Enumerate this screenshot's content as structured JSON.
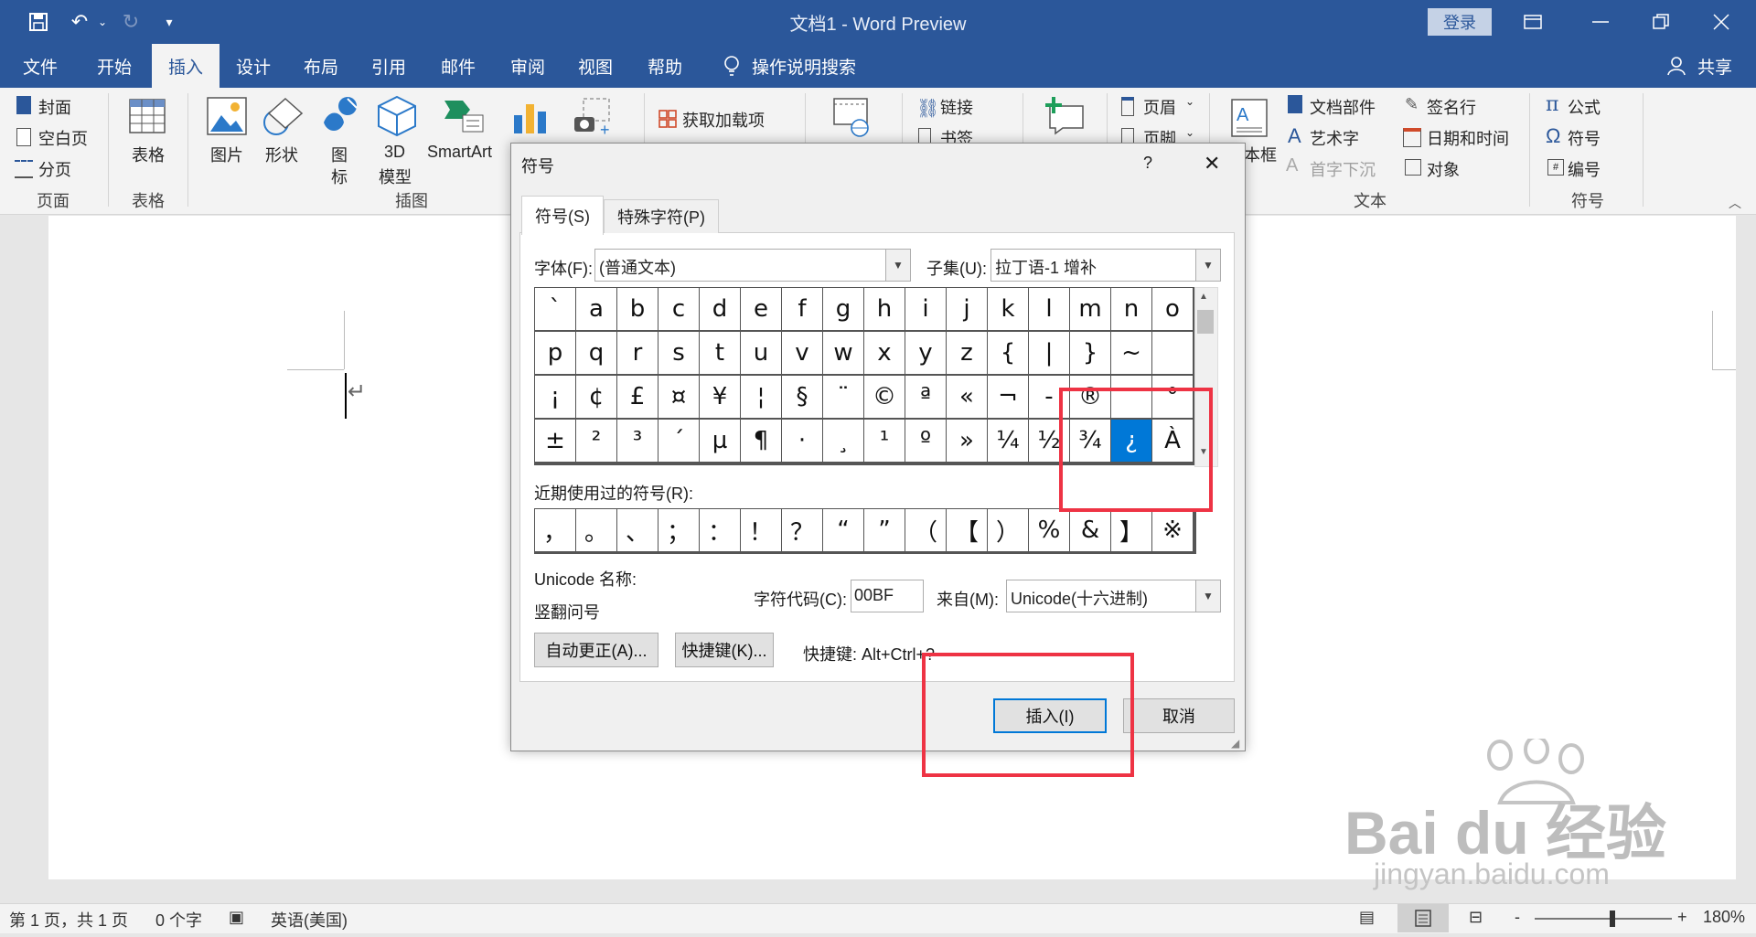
{
  "window": {
    "doc_title": "文档1  -  Word Preview",
    "login_label": "登录",
    "share_label": "共享"
  },
  "tabs": [
    "文件",
    "开始",
    "插入",
    "设计",
    "布局",
    "引用",
    "邮件",
    "审阅",
    "视图",
    "帮助"
  ],
  "tell_me": "操作说明搜索",
  "ribbon": {
    "pages": {
      "cover": "封面",
      "blank": "空白页",
      "break": "分页",
      "group": "页面"
    },
    "tables": {
      "table": "表格",
      "group": "表格"
    },
    "illustrations": {
      "picture": "图片",
      "shapes": "形状",
      "icons_1": "图",
      "icons_2": "标",
      "model_1": "3D",
      "model_2": "模型",
      "smartart": "SmartArt",
      "group": "插图"
    },
    "addins": {
      "get": "获取加载项"
    },
    "links": {
      "link": "链接",
      "bookmark": "书签"
    },
    "header_footer": {
      "header": "页眉",
      "footer": "页脚"
    },
    "text": {
      "textbox": "本框",
      "parts": "文档部件",
      "wordart": "艺术字",
      "dropcap": "首字下沉",
      "signature": "签名行",
      "datetime": "日期和时间",
      "object": "对象",
      "group": "文本"
    },
    "symbols": {
      "equation": "公式",
      "symbol": "符号",
      "number": "编号",
      "group": "符号"
    }
  },
  "dialog": {
    "title": "符号",
    "help": "?",
    "close": "✕",
    "tabs": [
      "符号(S)",
      "特殊字符(P)"
    ],
    "font_label": "字体(F):",
    "font_value": "(普通文本)",
    "subset_label": "子集(U):",
    "subset_value": "拉丁语-1 增补",
    "grid": [
      [
        "`",
        "a",
        "b",
        "c",
        "d",
        "e",
        "f",
        "g",
        "h",
        "i",
        "j",
        "k",
        "l",
        "m",
        "n",
        "o"
      ],
      [
        "p",
        "q",
        "r",
        "s",
        "t",
        "u",
        "v",
        "w",
        "x",
        "y",
        "z",
        "{",
        "|",
        "}",
        "~",
        ""
      ],
      [
        "¡",
        "¢",
        "£",
        "¤",
        "¥",
        "¦",
        "§",
        "¨",
        "©",
        "ª",
        "«",
        "¬",
        "-",
        "®",
        "",
        "°"
      ],
      [
        "±",
        "²",
        "³",
        "´",
        "µ",
        "¶",
        "·",
        "¸",
        "¹",
        "º",
        "»",
        "¼",
        "½",
        "¾",
        "¿",
        "À"
      ]
    ],
    "selected_char": "¿",
    "recent_label": "近期使用过的符号(R):",
    "recent": [
      "，",
      "。",
      "、",
      "；",
      "：",
      "！",
      "？",
      "“",
      "”",
      "（",
      "【",
      "）",
      "%",
      "&",
      "】",
      "※"
    ],
    "unicode_name_label": "Unicode 名称:",
    "unicode_name": "竖翻问号",
    "charcode_label": "字符代码(C):",
    "charcode_value": "00BF",
    "from_label": "来自(M):",
    "from_value": "Unicode(十六进制)",
    "autocorrect_btn": "自动更正(A)...",
    "shortcut_btn": "快捷键(K)...",
    "shortcut_text": "快捷键: Alt+Ctrl+?",
    "insert_btn": "插入(I)",
    "cancel_btn": "取消"
  },
  "status": {
    "page": "第 1 页，共 1 页",
    "words": "0 个字",
    "lang": "英语(美国)",
    "zoom": "180%",
    "minus": "-",
    "plus": "+"
  },
  "watermark": {
    "main": "Bai du 经验",
    "url": "jingyan.baidu.com"
  },
  "colors": {
    "brand": "#2b579a",
    "selection": "#0078d7",
    "annotation": "#ee3344"
  }
}
